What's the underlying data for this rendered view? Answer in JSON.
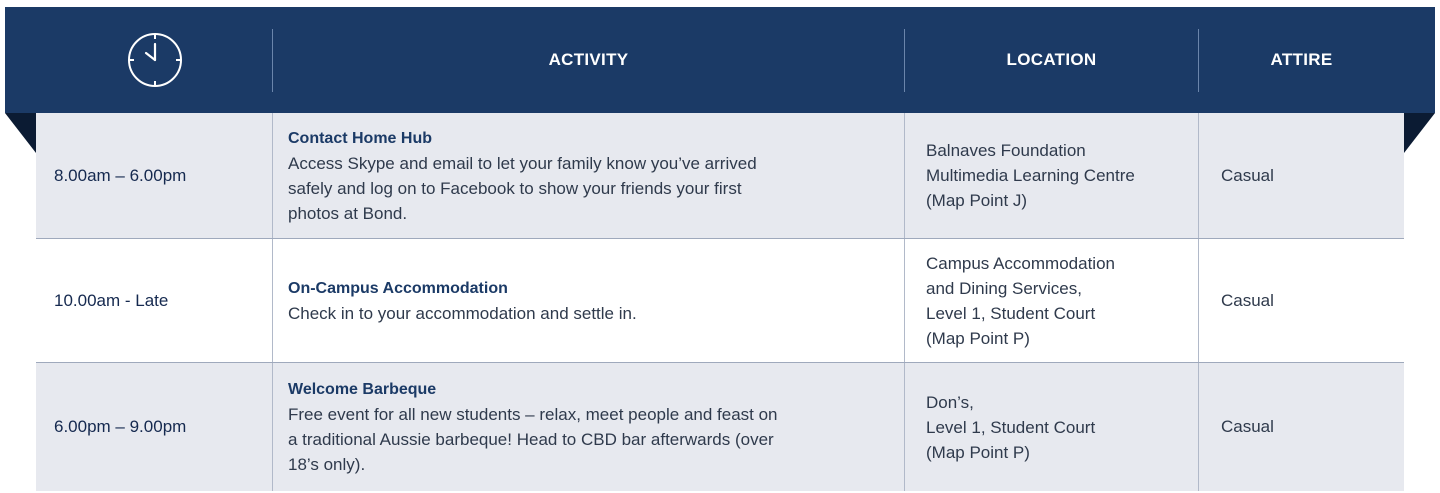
{
  "header": {
    "icon": "clock-icon",
    "columns": [
      "ACTIVITY",
      "LOCATION",
      "ATTIRE"
    ]
  },
  "rows": [
    {
      "time": "8.00am – 6.00pm",
      "title": "Contact Home Hub",
      "description": "Access Skype and email to let your family know you’ve arrived\nsafely and log on to Facebook to show your friends your first\nphotos at Bond.",
      "location": "Balnaves Foundation\nMultimedia Learning Centre\n(Map Point J)",
      "attire": "Casual"
    },
    {
      "time": "10.00am - Late",
      "title": "On-Campus Accommodation",
      "description": "Check in to your accommodation and settle in.",
      "location": "Campus Accommodation\nand Dining Services,\nLevel 1, Student Court\n(Map Point P)",
      "attire": "Casual"
    },
    {
      "time": "6.00pm – 9.00pm",
      "title": "Welcome Barbeque",
      "description": "Free event for all new students – relax, meet people and feast on\na traditional Aussie barbeque! Head to CBD bar afterwards (over\n18’s only).",
      "location": "Don’s,\nLevel 1, Student Court\n(Map Point P)",
      "attire": "Casual"
    }
  ],
  "colors": {
    "header_bg": "#1b3a66",
    "fold": "#0b1b33",
    "row_shade": "#e7e9ef",
    "title_text": "#1b3a66"
  }
}
